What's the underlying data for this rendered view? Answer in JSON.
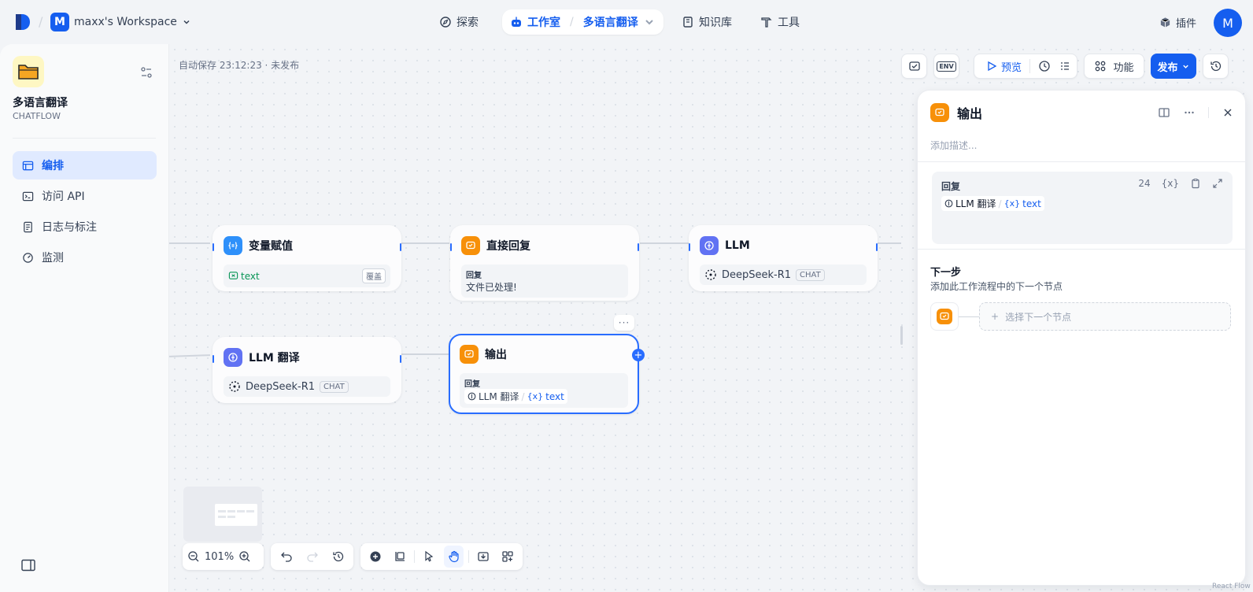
{
  "workspace": {
    "initial": "M",
    "name": "maxx's Workspace"
  },
  "nav": {
    "explore": "探索",
    "studio": "工作室",
    "app": "多语言翻译",
    "knowledge": "知识库",
    "tools": "工具",
    "plugins": "插件"
  },
  "user": {
    "initial": "M"
  },
  "sidebar": {
    "app_name": "多语言翻译",
    "app_type": "CHATFLOW",
    "items": [
      {
        "label": "编排",
        "icon": "layout-icon",
        "active": true
      },
      {
        "label": "访问 API",
        "icon": "terminal-icon"
      },
      {
        "label": "日志与标注",
        "icon": "document-icon"
      },
      {
        "label": "监测",
        "icon": "gauge-icon"
      }
    ]
  },
  "canvas": {
    "autosave": "自动保存 23:12:23 · 未发布",
    "toolbar": {
      "env": "ENV",
      "preview": "预览",
      "features": "功能",
      "publish": "发布"
    },
    "zoom": "101%"
  },
  "nodes": {
    "assign": {
      "title": "变量赋值",
      "var": "text",
      "mode": "覆盖"
    },
    "direct_reply": {
      "title": "直接回复",
      "label": "回复",
      "text": "文件已处理!"
    },
    "llm": {
      "title": "LLM",
      "model": "DeepSeek-R1",
      "tag": "CHAT"
    },
    "llm_translate": {
      "title": "LLM 翻译",
      "model": "DeepSeek-R1",
      "tag": "CHAT"
    },
    "output": {
      "title": "输出",
      "label": "回复",
      "source": "LLM 翻译",
      "var": "text",
      "more": "···"
    }
  },
  "panel": {
    "title": "输出",
    "desc_placeholder": "添加描述...",
    "reply_label": "回复",
    "char_count": "24",
    "var_btn": "{x}",
    "source": "LLM 翻译",
    "var": "text",
    "next_title": "下一步",
    "next_desc": "添加此工作流程中的下一个节点",
    "select_next": "选择下一个节点"
  },
  "footer": {
    "watermark": "React Flow"
  },
  "colors": {
    "accent": "#155eef",
    "orange": "#f79009",
    "indigo": "#6172f3",
    "blue": "#2e90fa"
  }
}
